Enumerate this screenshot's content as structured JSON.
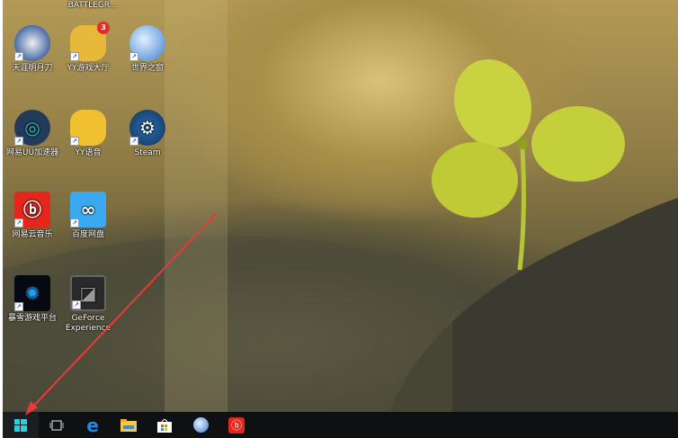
{
  "desktop": {
    "cut_label": "BATTLEGR...",
    "icons": [
      {
        "label": "天涯明月刀",
        "icon": "tianya-icon"
      },
      {
        "label": "YY游戏大厅",
        "icon": "yy-game-icon",
        "badge": "3"
      },
      {
        "label": "世界之窗",
        "icon": "theworld-browser-icon"
      },
      {
        "label": "网易UU加速器",
        "icon": "uu-accelerator-icon"
      },
      {
        "label": "YY语音",
        "icon": "yy-voice-icon"
      },
      {
        "label": "Steam",
        "icon": "steam-icon"
      },
      {
        "label": "网易云音乐",
        "icon": "netease-music-icon"
      },
      {
        "label": "百度网盘",
        "icon": "baidu-netdisk-icon"
      },
      {
        "label": "暴雪游戏平台",
        "icon": "battlenet-icon"
      },
      {
        "label": "GeForce Experience",
        "icon": "geforce-icon"
      }
    ]
  },
  "taskbar": {
    "items": [
      "start",
      "task-view",
      "edge",
      "file-explorer",
      "store",
      "theworld-browser",
      "netease-music"
    ],
    "start_color": "#2bd0e0"
  },
  "annotation": {
    "arrow_color": "#e83a3a"
  }
}
